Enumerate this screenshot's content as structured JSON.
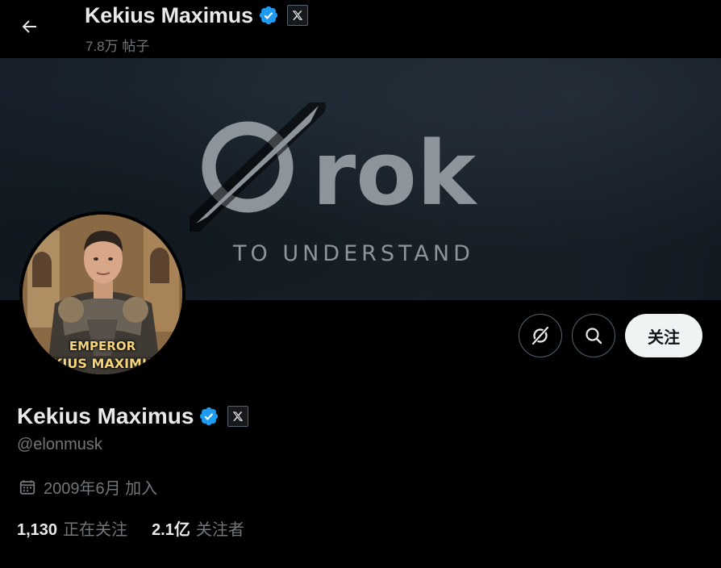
{
  "header": {
    "name": "Kekius Maximus",
    "posts_count": "7.8万 帖子"
  },
  "banner": {
    "logo_text": "Grok",
    "tagline": "TO UNDERSTAND"
  },
  "avatar": {
    "caption_line1": "EMPEROR",
    "caption_line2": "KIUS MAXIMU"
  },
  "actions": {
    "follow_label": "关注"
  },
  "profile": {
    "name": "Kekius Maximus",
    "handle": "@elonmusk",
    "joined": "2009年6月 加入",
    "following_count": "1,130",
    "following_label": "正在关注",
    "followers_count": "2.1亿",
    "followers_label": "关注者"
  },
  "colors": {
    "background": "#000000",
    "verified_blue": "#1d9bf0",
    "text_primary": "#e7e9ea",
    "text_secondary": "#71767b",
    "follow_button_bg": "#eff3f4"
  },
  "icons": [
    "back-arrow-icon",
    "verified-badge-icon",
    "x-affiliate-icon",
    "grok-icon",
    "search-icon",
    "calendar-icon"
  ]
}
